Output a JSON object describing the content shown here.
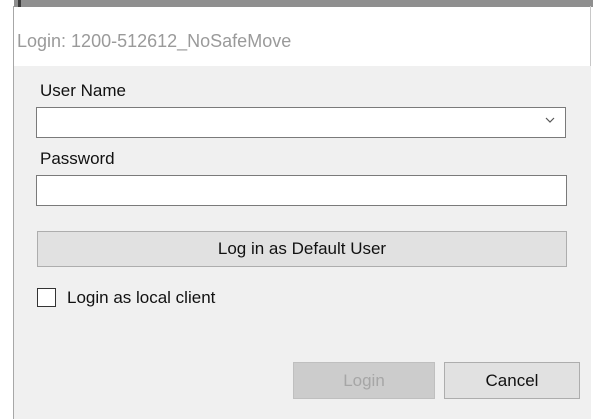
{
  "window": {
    "title": "Login: 1200-512612_NoSafeMove"
  },
  "form": {
    "username_label": "User Name",
    "username_value": "",
    "password_label": "Password",
    "password_value": "",
    "default_user_button": "Log in as Default User",
    "local_client_label": "Login as local client",
    "local_client_checked": false
  },
  "buttons": {
    "login_label": "Login",
    "login_enabled": false,
    "cancel_label": "Cancel"
  },
  "icons": {
    "dropdown": "chevron-down-icon"
  },
  "colors": {
    "dialog_bg": "#f0f0f0",
    "title_text": "#9a9a9a",
    "button_bg": "#e1e1e1",
    "disabled_button_bg": "#cccccc",
    "disabled_text": "#a6a6a6"
  }
}
